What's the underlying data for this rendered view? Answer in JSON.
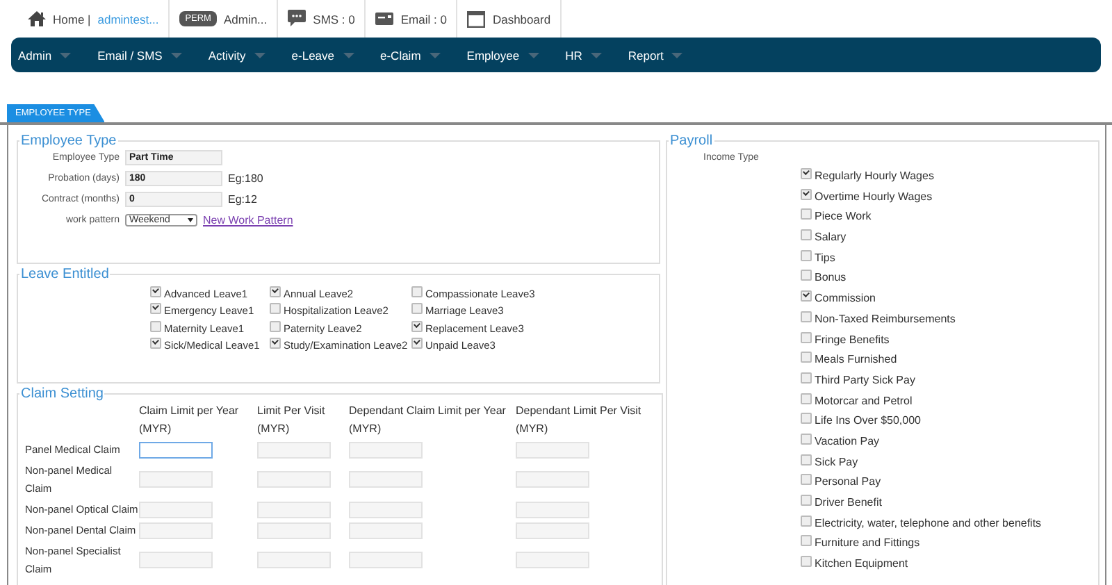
{
  "topbar": {
    "home": "Home |",
    "user": "admintest...",
    "perm_badge": "PERM",
    "perm_user": "Admin...",
    "sms": "SMS : 0",
    "email": "Email : 0",
    "dashboard": "Dashboard"
  },
  "menu": [
    "Admin",
    "Email / SMS",
    "Activity",
    "e-Leave",
    "e-Claim",
    "Employee",
    "HR",
    "Report"
  ],
  "tab": {
    "label": "EMPLOYEE TYPE",
    "selected": true
  },
  "employee_type": {
    "legend": "Employee Type",
    "fields": [
      {
        "kind": "text",
        "label": "Employee Type",
        "value": "Part Time"
      },
      {
        "kind": "text",
        "label": "Probation (days)",
        "value": "180",
        "hint": "Eg:180"
      },
      {
        "kind": "text",
        "label": "Contract (months)",
        "value": "0",
        "hint": "Eg:12"
      },
      {
        "kind": "select",
        "label": "work pattern",
        "value": "Weekend",
        "link": "New Work Pattern"
      }
    ]
  },
  "leave_entitled": {
    "legend": "Leave Entitled",
    "items": [
      {
        "label": "Advanced Leave1",
        "checked": true
      },
      {
        "label": "Annual Leave2",
        "checked": true
      },
      {
        "label": "Compassionate Leave3",
        "checked": false
      },
      {
        "label": "Emergency Leave1",
        "checked": true
      },
      {
        "label": "Hospitalization Leave2",
        "checked": false
      },
      {
        "label": "Marriage Leave3",
        "checked": false
      },
      {
        "label": "Maternity Leave1",
        "checked": false
      },
      {
        "label": "Paternity Leave2",
        "checked": false
      },
      {
        "label": "Replacement Leave3",
        "checked": true
      },
      {
        "label": "Sick/Medical Leave1",
        "checked": true
      },
      {
        "label": "Study/Examination Leave2",
        "checked": true
      },
      {
        "label": "Unpaid Leave3",
        "checked": true
      }
    ]
  },
  "claim_setting": {
    "legend": "Claim Setting",
    "columns": [
      "Claim Limit per Year (MYR)",
      "Limit Per Visit (MYR)",
      "Dependant Claim Limit per Year (MYR)",
      "Dependant Limit Per Visit (MYR)"
    ],
    "rows": [
      {
        "label": "Panel Medical Claim",
        "fields": [
          {
            "focused": true
          },
          {
            "focused": false
          },
          {
            "focused": false
          },
          {
            "focused": false
          }
        ]
      },
      {
        "label": "Non-panel Medical Claim",
        "fields": [
          {
            "focused": false
          },
          {
            "focused": false
          },
          {
            "focused": false
          },
          {
            "focused": false
          }
        ]
      },
      {
        "label": "Non-panel Optical Claim",
        "fields": [
          {
            "focused": false
          },
          {
            "focused": false
          },
          {
            "focused": false
          },
          {
            "focused": false
          }
        ]
      },
      {
        "label": "Non-panel Dental Claim",
        "fields": [
          {
            "focused": false
          },
          {
            "focused": false
          },
          {
            "focused": false
          },
          {
            "focused": false
          }
        ]
      },
      {
        "label": "Non-panel Specialist Claim",
        "fields": [
          {
            "focused": false
          },
          {
            "focused": false
          },
          {
            "focused": false
          },
          {
            "focused": false
          }
        ]
      }
    ]
  },
  "payroll": {
    "legend": "Payroll",
    "income_type_label": "Income Type",
    "items": [
      {
        "label": "Regularly Hourly Wages",
        "checked": true
      },
      {
        "label": "Overtime Hourly Wages",
        "checked": true
      },
      {
        "label": "Piece Work",
        "checked": false
      },
      {
        "label": "Salary",
        "checked": false
      },
      {
        "label": "Tips",
        "checked": false
      },
      {
        "label": "Bonus",
        "checked": false
      },
      {
        "label": "Commission",
        "checked": true
      },
      {
        "label": "Non-Taxed Reimbursements",
        "checked": false
      },
      {
        "label": "Fringe Benefits",
        "checked": false
      },
      {
        "label": "Meals Furnished",
        "checked": false
      },
      {
        "label": "Third Party Sick Pay",
        "checked": false
      },
      {
        "label": "Motorcar and Petrol",
        "checked": false
      },
      {
        "label": "Life Ins Over $50,000",
        "checked": false
      },
      {
        "label": "Vacation Pay",
        "checked": false
      },
      {
        "label": "Sick Pay",
        "checked": false
      },
      {
        "label": "Personal Pay",
        "checked": false
      },
      {
        "label": "Driver Benefit",
        "checked": false
      },
      {
        "label": "Electricity, water, telephone and other benefits",
        "checked": false
      },
      {
        "label": "Furniture and Fittings",
        "checked": false
      },
      {
        "label": "Kitchen Equipment",
        "checked": false
      }
    ]
  }
}
